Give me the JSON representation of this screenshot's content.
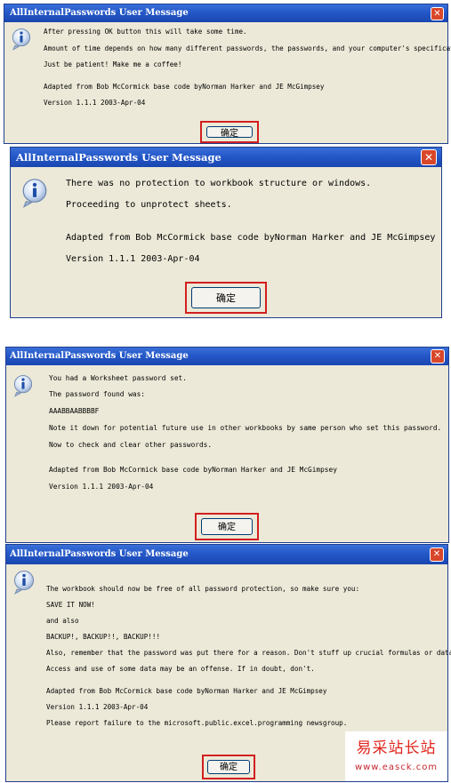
{
  "title": "AllInternalPasswords User Message",
  "ok_label": "确定",
  "close_glyph": "✕",
  "icon": "info-icon",
  "colors": {
    "titlebar": "#2458c8",
    "dialog_bg": "#ece9d8",
    "close_button": "#d9472b",
    "highlight_box": "#d21f1f",
    "watermark": "#e0261e"
  },
  "dialogs": [
    {
      "lines": [
        "After pressing OK button this will take some time.",
        "Amount of time depends on how many different passwords, the passwords, and your computer's specification.",
        "Just be patient! Make me a coffee!",
        "Adapted from Bob McCormick base code byNorman Harker and JE McGimpsey",
        "Version 1.1.1 2003-Apr-04"
      ]
    },
    {
      "lines": [
        "There was no protection to workbook structure or windows.",
        "Proceeding to unprotect sheets.",
        "Adapted from Bob McCormick base code byNorman Harker and JE McGimpsey",
        "Version 1.1.1 2003-Apr-04"
      ]
    },
    {
      "lines": [
        "You had a Worksheet password set.",
        "The password found was:",
        "AAABBAABBBBF",
        "Note it down for potential future use in other workbooks by same person who set this password.",
        "Now to check and clear other passwords.",
        "Adapted from Bob McCormick base code byNorman Harker and JE McGimpsey",
        "Version 1.1.1 2003-Apr-04"
      ]
    },
    {
      "lines": [
        "The workbook should now be free of all password protection, so make sure you:",
        "SAVE IT NOW!",
        "and also",
        "BACKUP!, BACKUP!!, BACKUP!!!",
        "Also, remember that the password was put there for a reason. Don't stuff up crucial formulas or data.",
        "Access and use of some data may be an offense. If in doubt, don't.",
        "Adapted from Bob McCormick base code byNorman Harker and JE McGimpsey",
        "Version 1.1.1 2003-Apr-04",
        "Please report failure to the microsoft.public.excel.programming newsgroup."
      ]
    }
  ],
  "watermark": {
    "title": "易采站长站",
    "url": "www.easck.com"
  }
}
